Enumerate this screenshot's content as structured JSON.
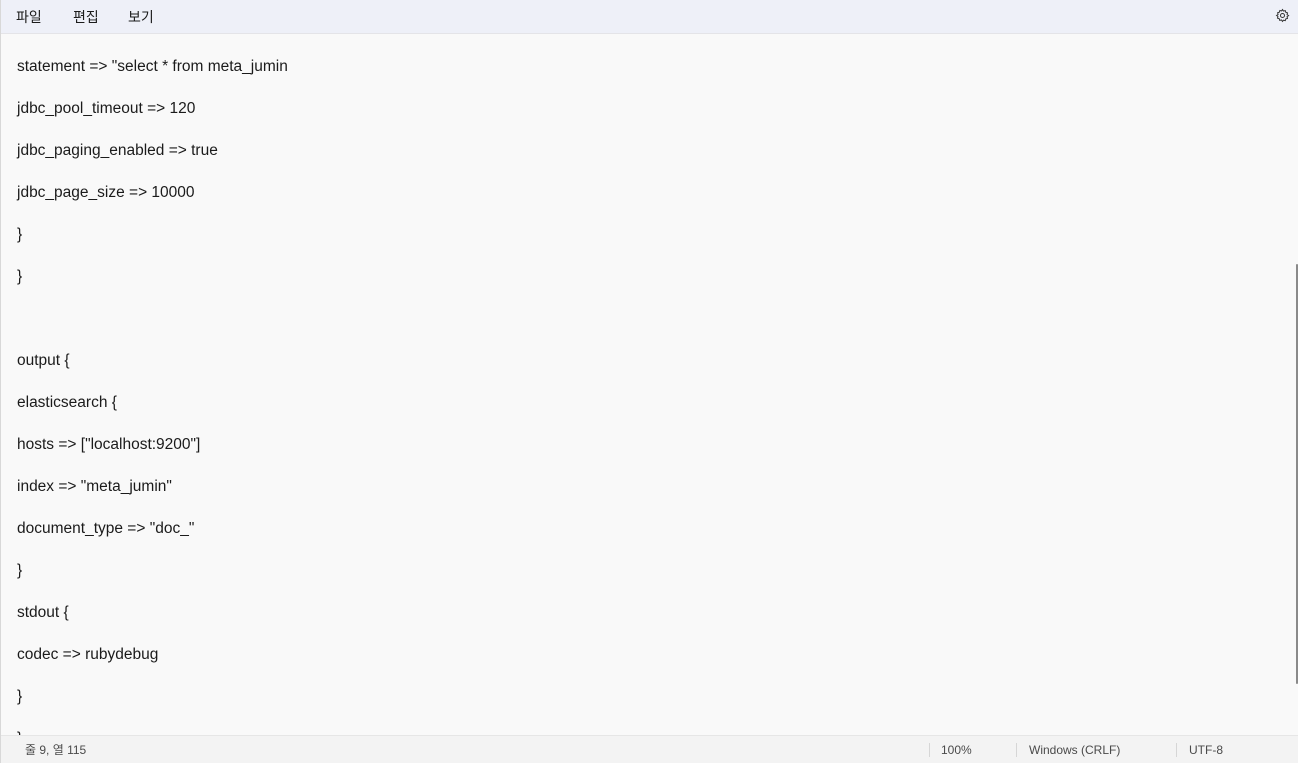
{
  "menu": {
    "file": "파일",
    "edit": "편집",
    "view": "보기"
  },
  "settings_icon": "gear-icon",
  "editor": {
    "lines": [
      "statement => \"select * from meta_jumin",
      "jdbc_pool_timeout => 120",
      "jdbc_paging_enabled => true",
      "jdbc_page_size => 10000",
      "}",
      "}",
      "",
      "output {",
      "elasticsearch {",
      "hosts => [\"localhost:9200\"]",
      "index => \"meta_jumin\"",
      "document_type => \"doc_\"",
      "}",
      "stdout {",
      "codec => rubydebug",
      "}",
      "}"
    ]
  },
  "statusbar": {
    "position": "줄 9, 열 115",
    "zoom": "100%",
    "line_ending": "Windows (CRLF)",
    "encoding": "UTF-8"
  },
  "colors": {
    "menubar_bg": "#eef0f8",
    "editor_bg": "#f9f9f9",
    "statusbar_bg": "#f3f3f3"
  }
}
